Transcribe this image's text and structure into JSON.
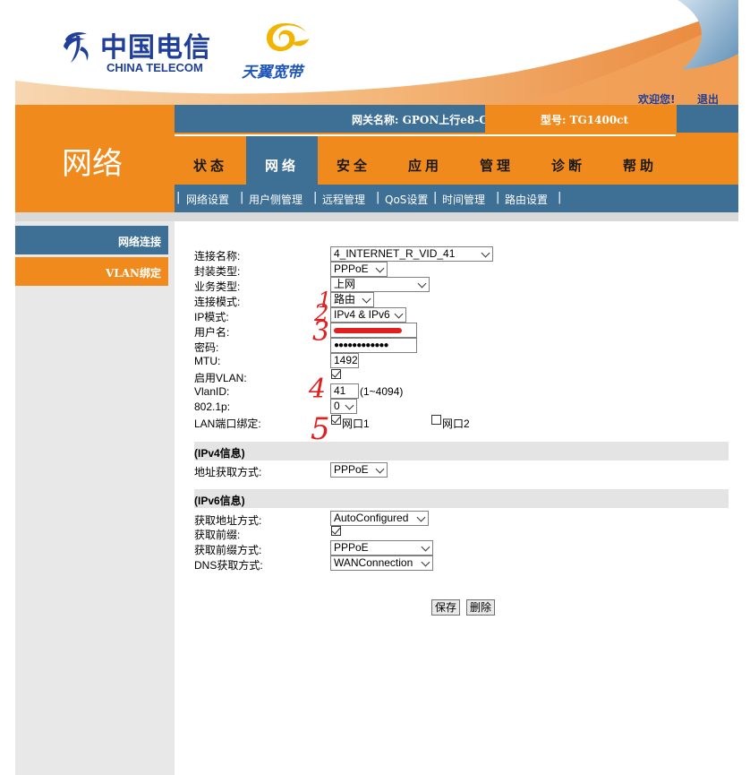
{
  "header": {
    "brand_cn": "中国电信",
    "brand_en": "CHINA TELECOM",
    "sub_brand": "天翼宽带",
    "welcome": "欢迎您!",
    "logout": "退出",
    "brand_color": "#1f3f9a"
  },
  "info_bar": {
    "gateway": "网关名称: GPON上行e8-C",
    "model": "型号: TG1400ct"
  },
  "nav_section_title": "网络",
  "tabs": [
    {
      "label": "状态"
    },
    {
      "label": "网络"
    },
    {
      "label": "安全"
    },
    {
      "label": "应用"
    },
    {
      "label": "管理"
    },
    {
      "label": "诊断"
    },
    {
      "label": "帮助"
    }
  ],
  "active_tab": "网络",
  "sub_menu": [
    {
      "label": "网络设置"
    },
    {
      "label": "用户侧管理"
    },
    {
      "label": "远程管理"
    },
    {
      "label": "QoS设置"
    },
    {
      "label": "时间管理"
    },
    {
      "label": "路由设置"
    }
  ],
  "side_menu": [
    {
      "label": "网络连接"
    },
    {
      "label": "VLAN绑定"
    }
  ],
  "form": {
    "connection_name": {
      "label": "连接名称:",
      "value": "4_INTERNET_R_VID_41"
    },
    "encap_type": {
      "label": "封装类型:",
      "value": "PPPoE"
    },
    "service_type": {
      "label": "业务类型:",
      "value": "上网"
    },
    "connection_mode": {
      "label": "连接模式:",
      "value": "路由"
    },
    "ip_mode": {
      "label": "IP模式:",
      "value": "IPv4 & IPv6"
    },
    "username": {
      "label": "用户名:",
      "value": ""
    },
    "password": {
      "label": "密码:",
      "value": "●●●●●●●●●●●●"
    },
    "mtu": {
      "label": "MTU:",
      "value": "1492"
    },
    "enable_vlan": {
      "label": "启用VLAN:",
      "checked": true
    },
    "vlan_id": {
      "label": "VlanID:",
      "value": "41",
      "range": "(1~4094)"
    },
    "dot1p": {
      "label": "802.1p:",
      "value": "0"
    },
    "lan_bind": {
      "label": "LAN端口绑定:",
      "port1": "网口1",
      "port1_checked": true,
      "port2": "网口2",
      "port2_checked": false
    }
  },
  "ipv4": {
    "section_title": "(IPv4信息)",
    "addr_mode": {
      "label": "地址获取方式:",
      "value": "PPPoE"
    }
  },
  "ipv6": {
    "section_title": "(IPv6信息)",
    "addr_mode": {
      "label": "获取地址方式:",
      "value": "AutoConfigured"
    },
    "get_prefix": {
      "label": "获取前缀:",
      "checked": true
    },
    "prefix_mode": {
      "label": "获取前缀方式:",
      "value": "PPPoE"
    },
    "dns_mode": {
      "label": "DNS获取方式:",
      "value": "WANConnection"
    }
  },
  "buttons": {
    "save": "保存",
    "delete": "删除"
  },
  "annotations": [
    "1",
    "2",
    "3",
    "4",
    "5"
  ],
  "colors": {
    "orange": "#f08a1c",
    "steel_blue": "#3e6f94",
    "annotation_red": "#e02020"
  }
}
